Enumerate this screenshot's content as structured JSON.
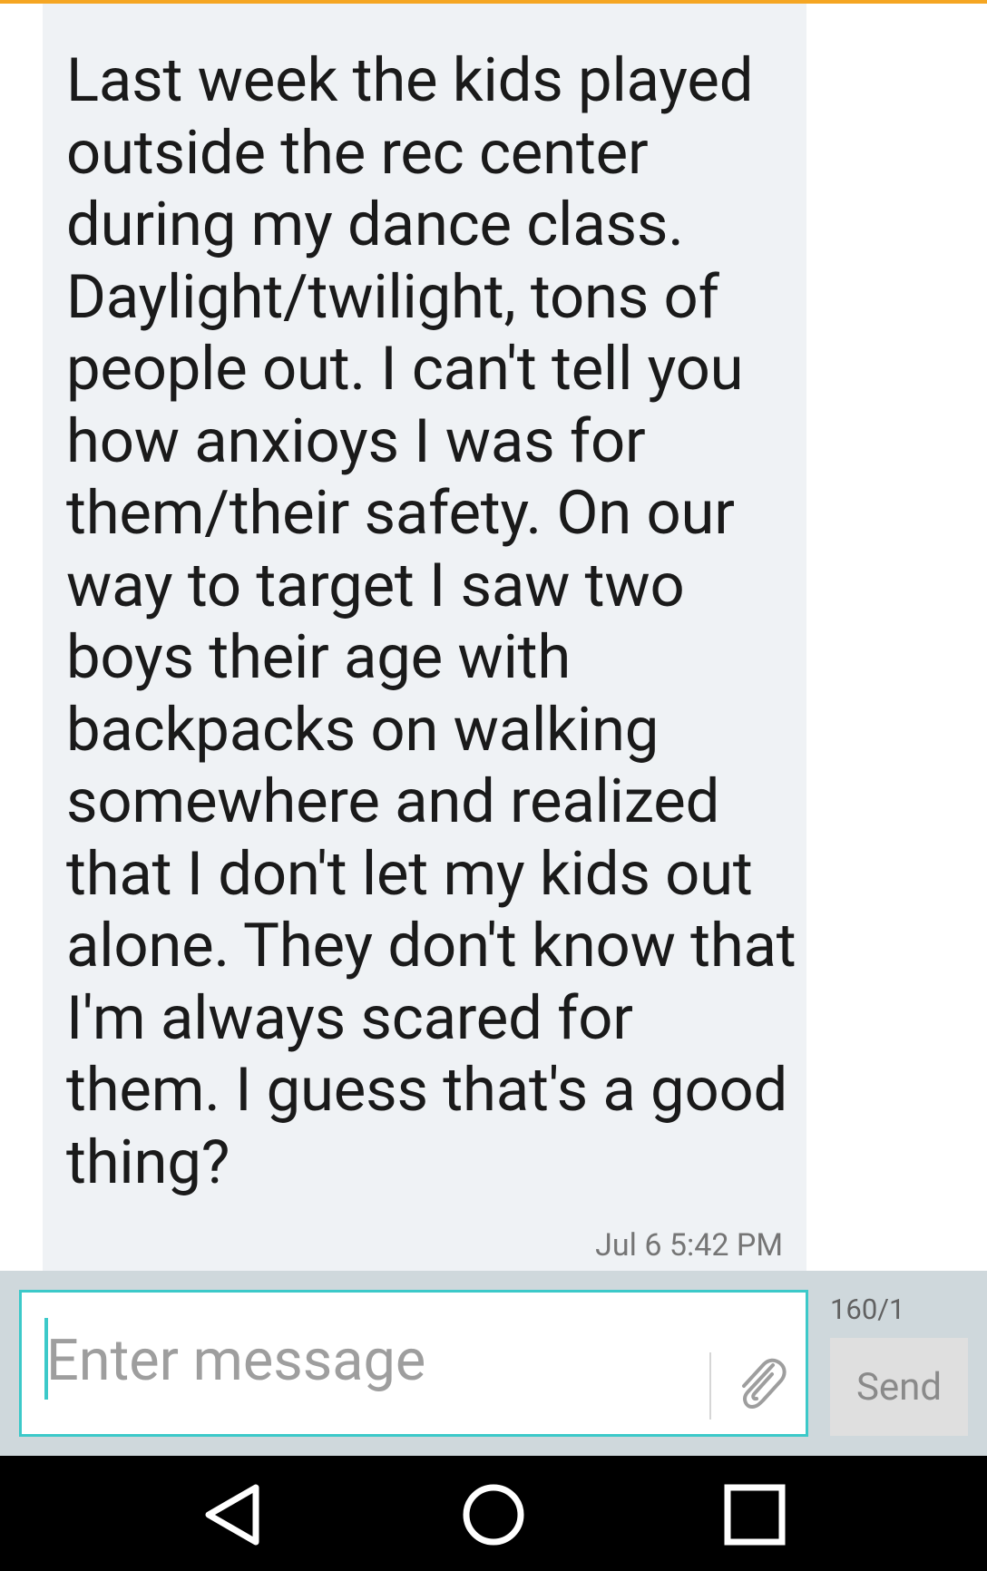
{
  "message": {
    "text": "Last week the kids played outside the rec center during my dance class. Daylight/twilight, tons of people out. I can't tell you how anxioys I was for them/their safety. On our way to target I saw two boys their age with backpacks on walking somewhere and realized that I don't let my kids out alone. They don't know that I'm always scared for them. I guess that's a good thing?",
    "timestamp": "Jul 6 5:42 PM"
  },
  "composer": {
    "placeholder": "Enter message",
    "value": "",
    "char_counter": "160/1",
    "send_label": "Send",
    "attach_icon": "paperclip-icon"
  },
  "nav": {
    "back_icon": "back-triangle-icon",
    "home_icon": "home-circle-icon",
    "recents_icon": "recents-square-icon"
  },
  "colors": {
    "accent_top": "#f5a623",
    "input_border": "#3cc9c9",
    "bubble_bg": "#eff2f5",
    "composer_bg": "#cfd8dc"
  }
}
